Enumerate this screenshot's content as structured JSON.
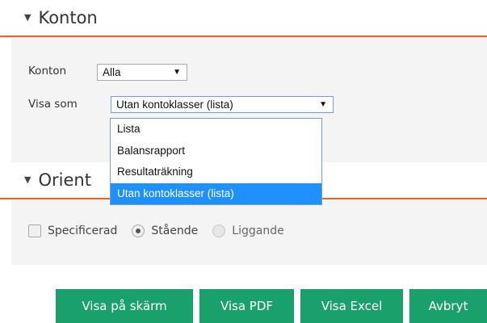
{
  "sections": {
    "konton": {
      "title": "Konton",
      "caret_icon": "caret-down-icon"
    },
    "orientering": {
      "title": "Orient",
      "caret_icon": "caret-down-icon"
    }
  },
  "konton_field": {
    "label": "Konton",
    "value": "Alla"
  },
  "visa_som_field": {
    "label": "Visa som",
    "value": "Utan kontoklasser (lista)",
    "options": [
      "Lista",
      "Balansrapport",
      "Resultaträkning",
      "Utan kontoklasser (lista)"
    ],
    "selected_index": 3
  },
  "options": {
    "specificerad": {
      "label": "Specificerad",
      "checked": false
    },
    "staende": {
      "label": "Stående",
      "checked": true
    },
    "liggande": {
      "label": "Liggande",
      "checked": false,
      "disabled": true
    }
  },
  "buttons": {
    "visa_skarm": "Visa på skärm",
    "visa_pdf": "Visa PDF",
    "visa_excel": "Visa Excel",
    "avbryt": "Avbryt"
  },
  "colors": {
    "accent": "#e8651a",
    "button": "#1aa06b",
    "selected_option": "#1e90ff",
    "panel_bg": "#f4f4f4"
  }
}
